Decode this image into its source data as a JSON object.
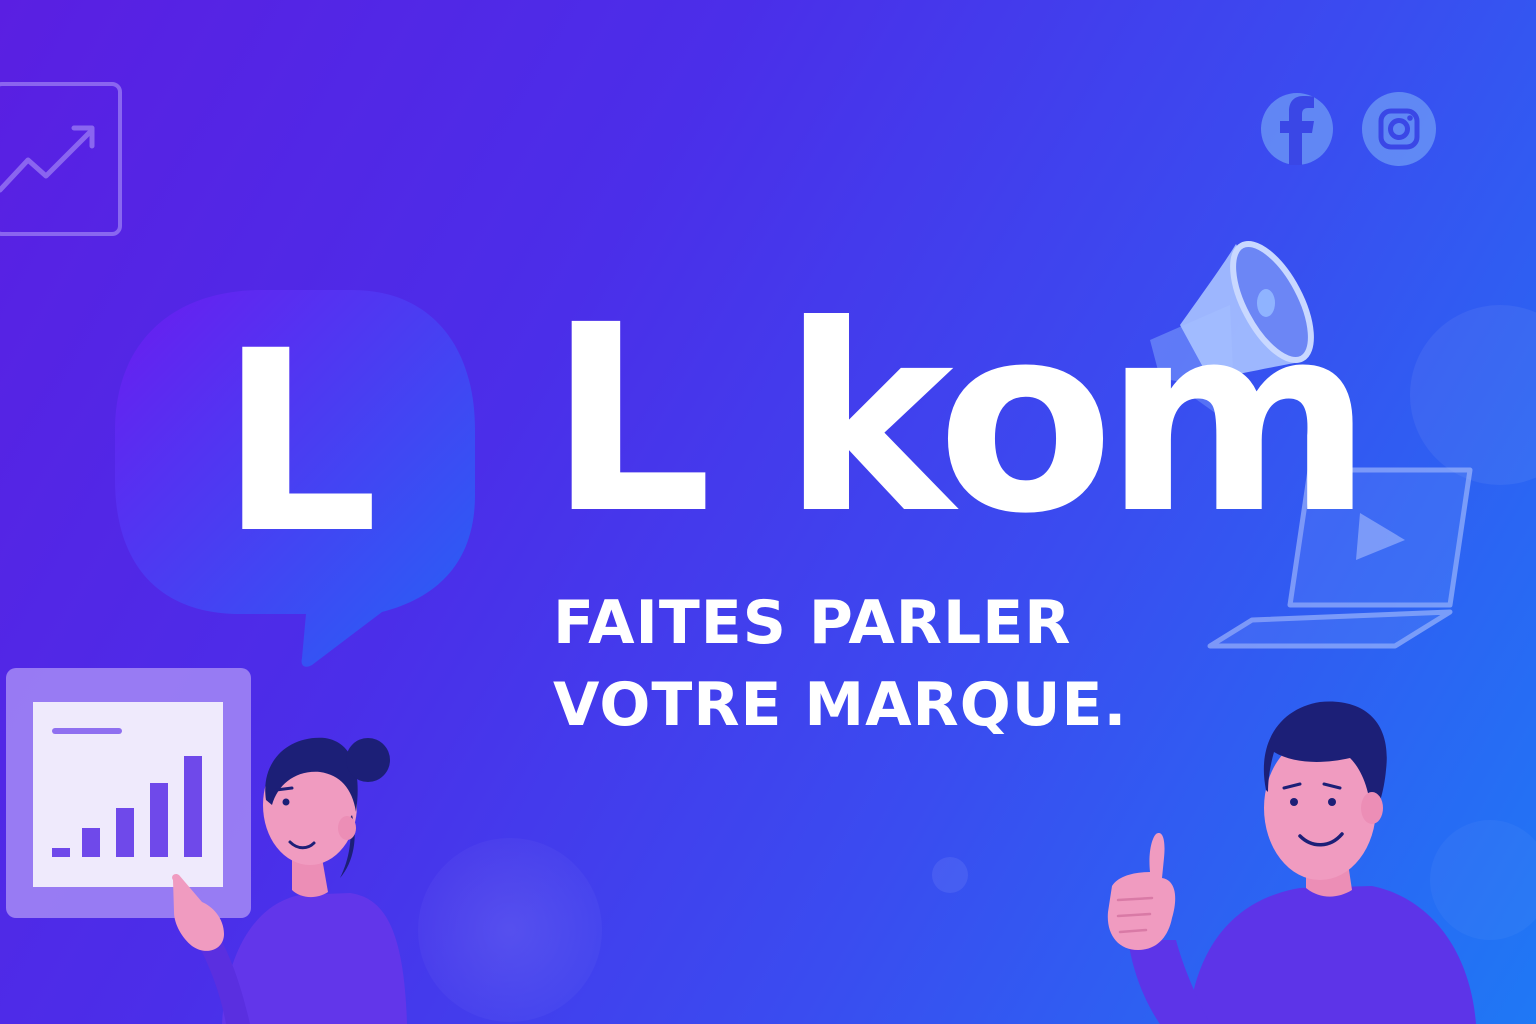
{
  "brand": {
    "name": "L kom",
    "logo_letter": "L",
    "tagline_lines": [
      "FAITES PARLER",
      "VOTRE MARQUE."
    ]
  },
  "icons": [
    "trend-chart-icon",
    "facebook-icon",
    "instagram-icon",
    "megaphone-icon",
    "laptop-play-icon",
    "bar-chart-board-icon"
  ],
  "colors": {
    "background_start": "#5a1fe2",
    "background_end": "#1f78f5",
    "bubble_start": "#6a1cf0",
    "bubble_end": "#2a5cf5",
    "text": "#ffffff"
  }
}
